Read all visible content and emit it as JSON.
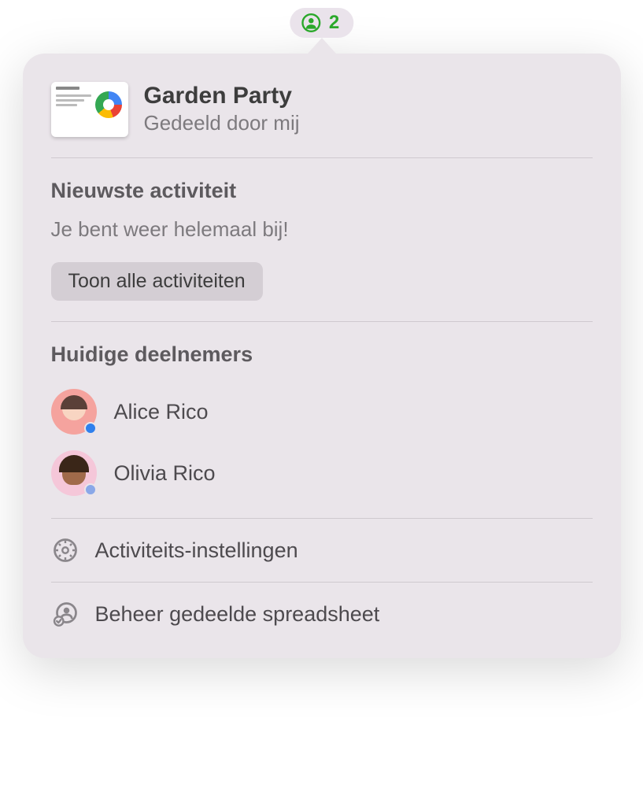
{
  "pill": {
    "count": "2"
  },
  "document": {
    "title": "Garden Party",
    "subtitle": "Gedeeld door mij"
  },
  "activity": {
    "heading": "Nieuwste activiteit",
    "status": "Je bent weer helemaal bij!",
    "show_all_label": "Toon alle activiteiten"
  },
  "participants": {
    "heading": "Huidige deelnemers",
    "list": [
      {
        "name": "Alice Rico",
        "dot_color": "#2f80ed"
      },
      {
        "name": "Olivia Rico",
        "dot_color": "#8aa8e8"
      }
    ]
  },
  "menu": {
    "activity_settings": "Activiteits-instellingen",
    "manage_shared": "Beheer gedeelde spreadsheet"
  }
}
